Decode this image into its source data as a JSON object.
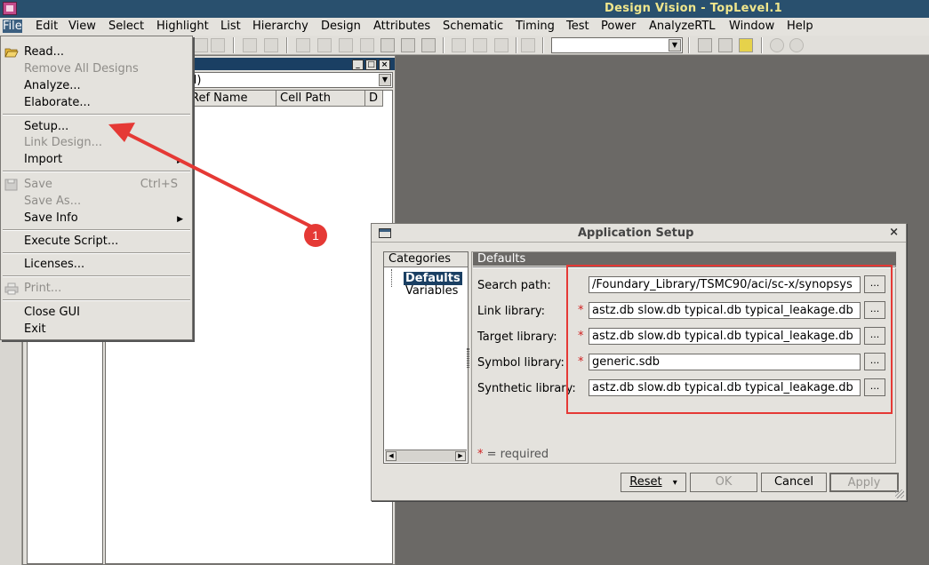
{
  "window": {
    "title": "Design Vision - TopLevel.1"
  },
  "menubar": {
    "items": [
      "File",
      "Edit",
      "View",
      "Select",
      "Highlight",
      "List",
      "Hierarchy",
      "Design",
      "Attributes",
      "Schematic",
      "Timing",
      "Test",
      "Power",
      "AnalyzeRTL",
      "Window",
      "Help"
    ]
  },
  "file_menu": {
    "items": [
      {
        "label": "Read...",
        "enabled": true
      },
      {
        "label": "Remove All Designs",
        "enabled": false
      },
      {
        "label": "Analyze...",
        "enabled": true
      },
      {
        "label": "Elaborate...",
        "enabled": true
      },
      {
        "label": "Setup...",
        "enabled": true
      },
      {
        "label": "Link Design...",
        "enabled": false
      },
      {
        "label": "Import",
        "enabled": true
      },
      {
        "label": "Save",
        "enabled": false,
        "shortcut": "Ctrl+S"
      },
      {
        "label": "Save As...",
        "enabled": false
      },
      {
        "label": "Save Info",
        "enabled": true
      },
      {
        "label": "Execute Script...",
        "enabled": true
      },
      {
        "label": "Licenses...",
        "enabled": true
      },
      {
        "label": "Print...",
        "enabled": false
      },
      {
        "label": "Close GUI",
        "enabled": true
      },
      {
        "label": "Exit",
        "enabled": true
      }
    ]
  },
  "hierarchy": {
    "combo_value": "ical)",
    "columns": [
      "Ref Name",
      "Cell Path",
      "D"
    ]
  },
  "dialog": {
    "title": "Application Setup",
    "close_glyph": "×",
    "categories_header": "Categories",
    "categories": [
      "Defaults",
      "Variables"
    ],
    "selected_category": "Defaults",
    "section_title": "Defaults",
    "fields": [
      {
        "label": "Search path:",
        "required": false,
        "value": "/Foundary_Library/TSMC90/aci/sc-x/synopsys"
      },
      {
        "label": "Link library:",
        "required": true,
        "value": "astz.db slow.db typical.db typical_leakage.db"
      },
      {
        "label": "Target library:",
        "required": true,
        "value": "astz.db slow.db typical.db typical_leakage.db"
      },
      {
        "label": "Symbol library:",
        "required": true,
        "value": " generic.sdb"
      },
      {
        "label": "Synthetic library:",
        "required": false,
        "value": "astz.db slow.db typical.db typical_leakage.db"
      }
    ],
    "browse_label": "...",
    "required_star": "*",
    "required_note": " = required",
    "buttons": {
      "reset": "Reset",
      "reset_arrow": "▾",
      "ok": "OK",
      "cancel": "Cancel",
      "apply": "Apply"
    }
  },
  "annotation": {
    "badge": "1",
    "color": "#e53935"
  }
}
